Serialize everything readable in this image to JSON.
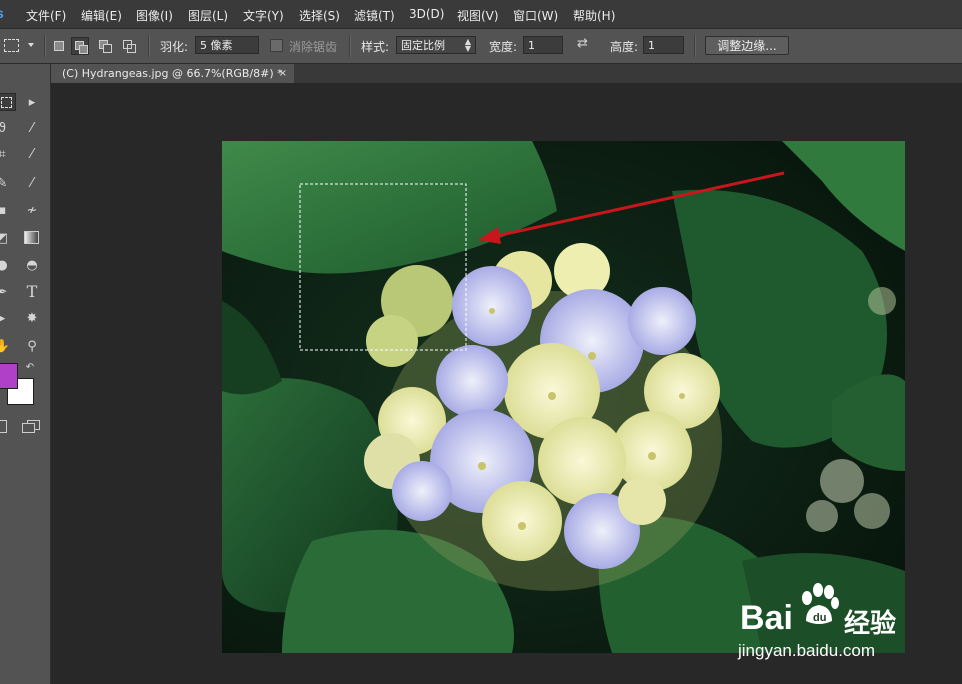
{
  "menu": [
    "文件(F)",
    "编辑(E)",
    "图像(I)",
    "图层(L)",
    "文字(Y)",
    "选择(S)",
    "滤镜(T)",
    "3D(D)",
    "视图(V)",
    "窗口(W)",
    "帮助(H)"
  ],
  "options": {
    "feather_label": "羽化:",
    "feather_value": "5 像素",
    "antialias_label": "消除锯齿",
    "style_label": "样式:",
    "style_value": "固定比例",
    "width_label": "宽度:",
    "width_value": "1",
    "height_label": "高度:",
    "height_value": "1",
    "refine_label": "调整边缘..."
  },
  "document": {
    "tab_title": "(C) Hydrangeas.jpg @ 66.7%(RGB/8#) *",
    "close": "×"
  },
  "colors": {
    "foreground": "#b040c8",
    "background": "#ffffff",
    "arrow": "#c8161c",
    "accent": "#4aa3ef"
  },
  "icons": {
    "tool_glyphs": [
      "T"
    ],
    "swap": "↶"
  },
  "watermark": {
    "brand_text": "Bai",
    "brand_tail": "经验",
    "url": "jingyan.baidu.com"
  }
}
